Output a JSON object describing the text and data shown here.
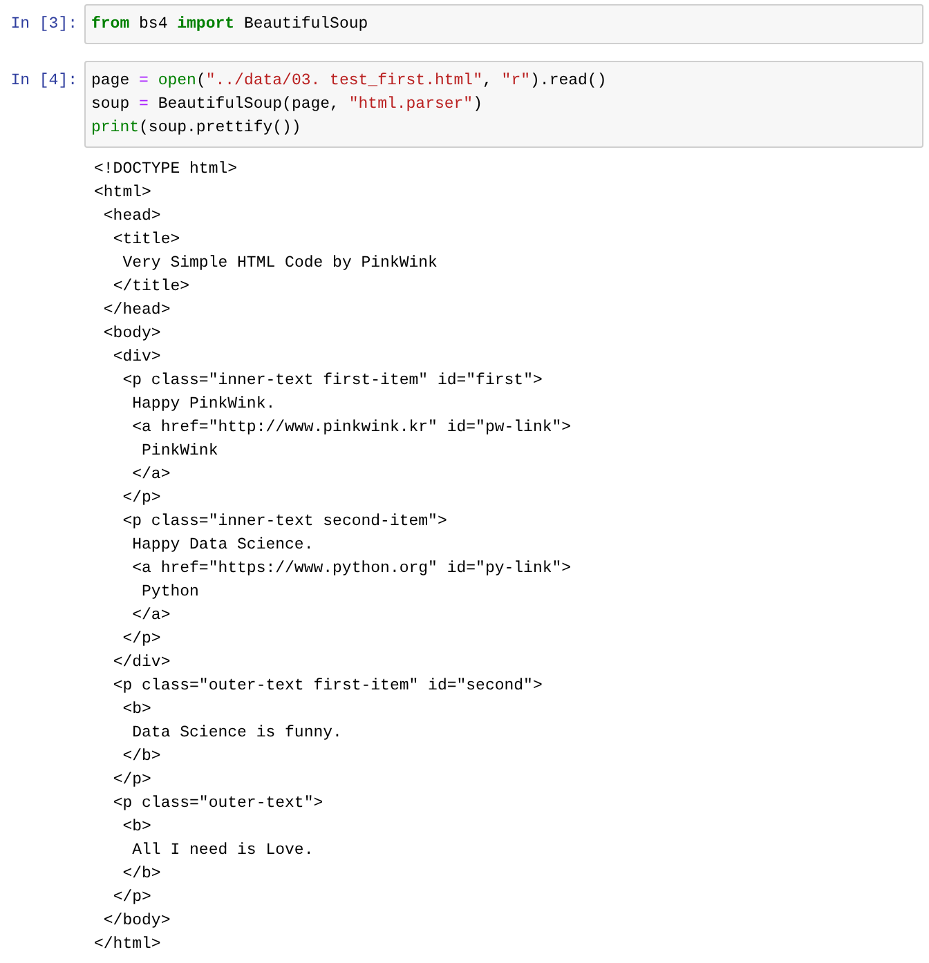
{
  "cells": [
    {
      "prompt": "In [3]:",
      "input": [
        [
          {
            "kind": "keyword",
            "text": "from"
          },
          {
            "kind": "plain",
            "text": " bs4 "
          },
          {
            "kind": "keyword",
            "text": "import"
          },
          {
            "kind": "plain",
            "text": " BeautifulSoup"
          }
        ]
      ]
    },
    {
      "prompt": "In [4]:",
      "input": [
        [
          {
            "kind": "plain",
            "text": "page "
          },
          {
            "kind": "operator",
            "text": "="
          },
          {
            "kind": "builtin",
            "text": " open"
          },
          {
            "kind": "plain",
            "text": "("
          },
          {
            "kind": "string",
            "text": "\"../data/03. test_first.html\""
          },
          {
            "kind": "plain",
            "text": ", "
          },
          {
            "kind": "string",
            "text": "\"r\""
          },
          {
            "kind": "plain",
            "text": ").read()"
          }
        ],
        [
          {
            "kind": "plain",
            "text": "soup "
          },
          {
            "kind": "operator",
            "text": "="
          },
          {
            "kind": "plain",
            "text": " BeautifulSoup(page, "
          },
          {
            "kind": "string",
            "text": "\"html.parser\""
          },
          {
            "kind": "plain",
            "text": ")"
          }
        ],
        [
          {
            "kind": "builtin",
            "text": "print"
          },
          {
            "kind": "plain",
            "text": "(soup.prettify())"
          }
        ]
      ],
      "output": [
        "<!DOCTYPE html>",
        "<html>",
        " <head>",
        "  <title>",
        "   Very Simple HTML Code by PinkWink",
        "  </title>",
        " </head>",
        " <body>",
        "  <div>",
        "   <p class=\"inner-text first-item\" id=\"first\">",
        "    Happy PinkWink.",
        "    <a href=\"http://www.pinkwink.kr\" id=\"pw-link\">",
        "     PinkWink",
        "    </a>",
        "   </p>",
        "   <p class=\"inner-text second-item\">",
        "    Happy Data Science.",
        "    <a href=\"https://www.python.org\" id=\"py-link\">",
        "     Python",
        "    </a>",
        "   </p>",
        "  </div>",
        "  <p class=\"outer-text first-item\" id=\"second\">",
        "   <b>",
        "    Data Science is funny.",
        "   </b>",
        "  </p>",
        "  <p class=\"outer-text\">",
        "   <b>",
        "    All I need is Love.",
        "   </b>",
        "  </p>",
        " </body>",
        "</html>"
      ]
    }
  ]
}
